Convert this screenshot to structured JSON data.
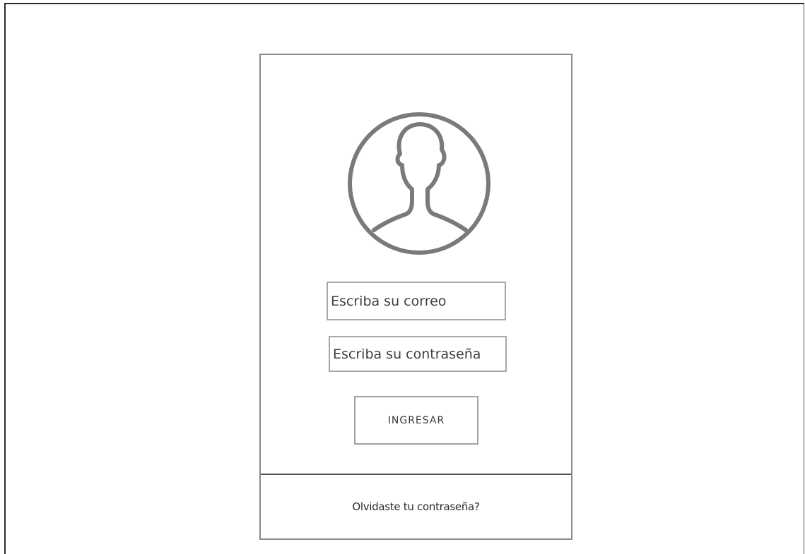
{
  "login": {
    "avatar_icon": "user-avatar-icon",
    "email_placeholder": "Escriba su correo",
    "password_placeholder": "Escriba su contraseña",
    "submit_label": "INGRESAR",
    "forgot_password_label": "Olvidaste tu contraseña?"
  },
  "colors": {
    "card_border": "#8a8a8a",
    "avatar_stroke": "#7a7a7a",
    "field_border": "#a8a8a8"
  }
}
